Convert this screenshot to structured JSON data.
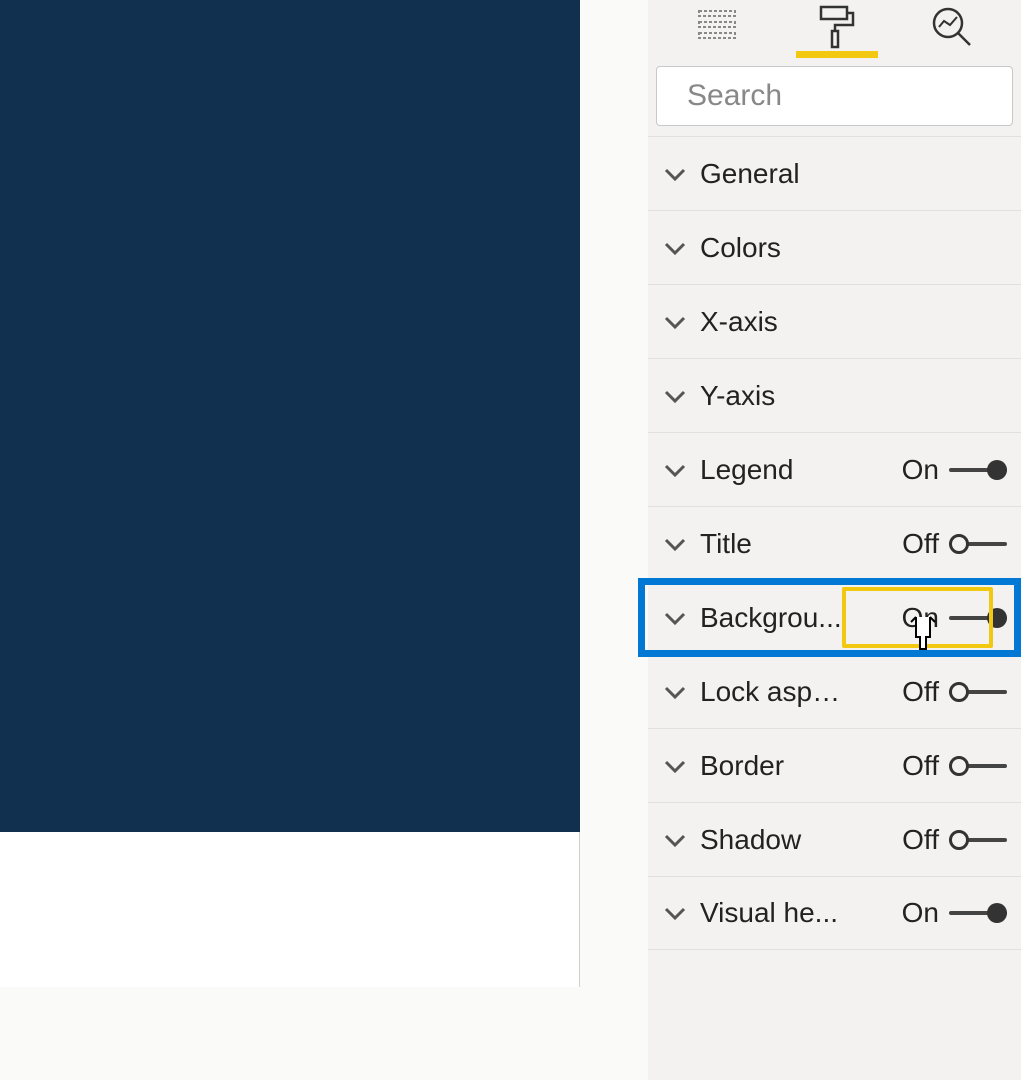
{
  "search": {
    "placeholder": "Search"
  },
  "tabs": {
    "fields": "fields",
    "format": "format",
    "analytics": "analytics"
  },
  "toggle_states": {
    "on": "On",
    "off": "Off"
  },
  "rows": [
    {
      "label": "General",
      "has_toggle": false
    },
    {
      "label": "Colors",
      "has_toggle": false
    },
    {
      "label": "X-axis",
      "has_toggle": false
    },
    {
      "label": "Y-axis",
      "has_toggle": false
    },
    {
      "label": "Legend",
      "has_toggle": true,
      "state": "On"
    },
    {
      "label": "Title",
      "has_toggle": true,
      "state": "Off"
    },
    {
      "label": "Backgrou...",
      "has_toggle": true,
      "state": "On",
      "highlighted": true
    },
    {
      "label": "Lock aspe...",
      "has_toggle": true,
      "state": "Off"
    },
    {
      "label": "Border",
      "has_toggle": true,
      "state": "Off"
    },
    {
      "label": "Shadow",
      "has_toggle": true,
      "state": "Off"
    },
    {
      "label": "Visual he...",
      "has_toggle": true,
      "state": "On"
    }
  ]
}
